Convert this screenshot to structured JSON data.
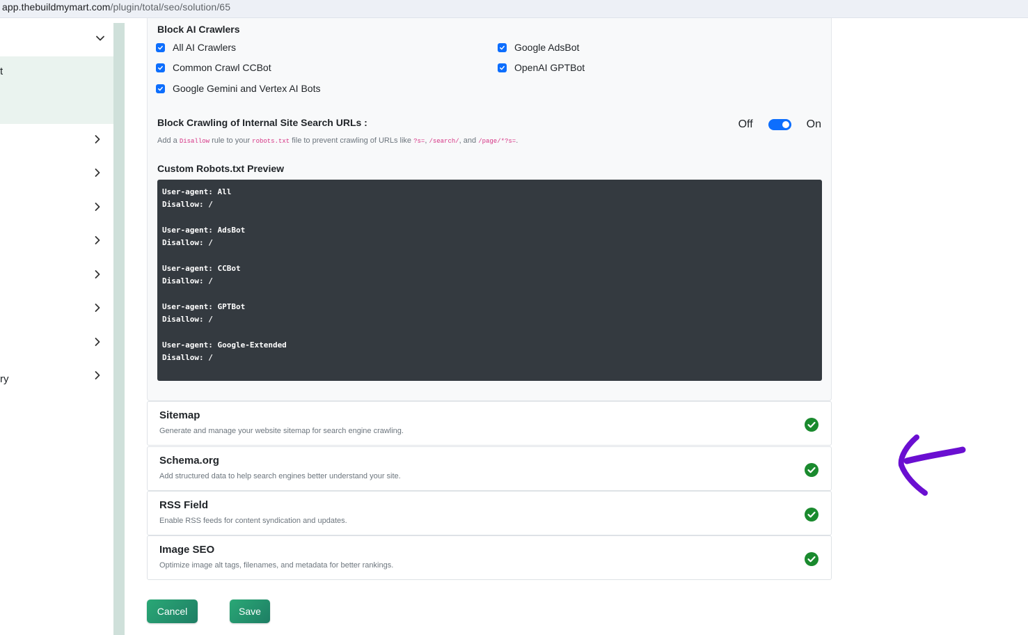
{
  "browser": {
    "url_host": "app.thebuildmymart.com",
    "url_path": "/plugin/total/seo/solution/65"
  },
  "sidebar": {
    "truncated_item_1": "t",
    "truncated_item_2": "ry"
  },
  "robots": {
    "block_ai_title": "Block AI Crawlers",
    "crawlers": [
      {
        "label": "All AI Crawlers",
        "checked": true
      },
      {
        "label": "Google AdsBot",
        "checked": true
      },
      {
        "label": "Common Crawl CCBot",
        "checked": true
      },
      {
        "label": "OpenAI GPTBot",
        "checked": true
      },
      {
        "label": "Google Gemini and Vertex AI Bots",
        "checked": true
      }
    ],
    "internal_search_title": "Block Crawling of Internal Site Search URLs :",
    "toggle_off": "Off",
    "toggle_on": "On",
    "toggle_state": "on",
    "help": {
      "t1": "Add a ",
      "c1": "Disallow",
      "t2": " rule to your ",
      "c2": "robots.txt",
      "t3": " file to prevent crawling of URLs like ",
      "c3": "?s=",
      "t4": ", ",
      "c4": "/search/",
      "t5": ", and ",
      "c5": "/page/*?s=",
      "t6": "."
    },
    "preview_title": "Custom Robots.txt Preview",
    "preview_text": "User-agent: All\nDisallow: /\n\nUser-agent: AdsBot\nDisallow: /\n\nUser-agent: CCBot\nDisallow: /\n\nUser-agent: GPTBot\nDisallow: /\n\nUser-agent: Google-Extended\nDisallow: /"
  },
  "sections": [
    {
      "title": "Sitemap",
      "desc": "Generate and manage your website sitemap for search engine crawling.",
      "enabled": true
    },
    {
      "title": "Schema.org",
      "desc": "Add structured data to help search engines better understand your site.",
      "enabled": true
    },
    {
      "title": "RSS Field",
      "desc": "Enable RSS feeds for content syndication and updates.",
      "enabled": true
    },
    {
      "title": "Image SEO",
      "desc": "Optimize image alt tags, filenames, and metadata for better rankings.",
      "enabled": true
    }
  ],
  "actions": {
    "cancel": "Cancel",
    "save": "Save"
  },
  "colors": {
    "accent": "#0d6efd",
    "success": "#1a8a2e",
    "button": "#1e8a6a",
    "annotation": "#6a0fd1"
  }
}
